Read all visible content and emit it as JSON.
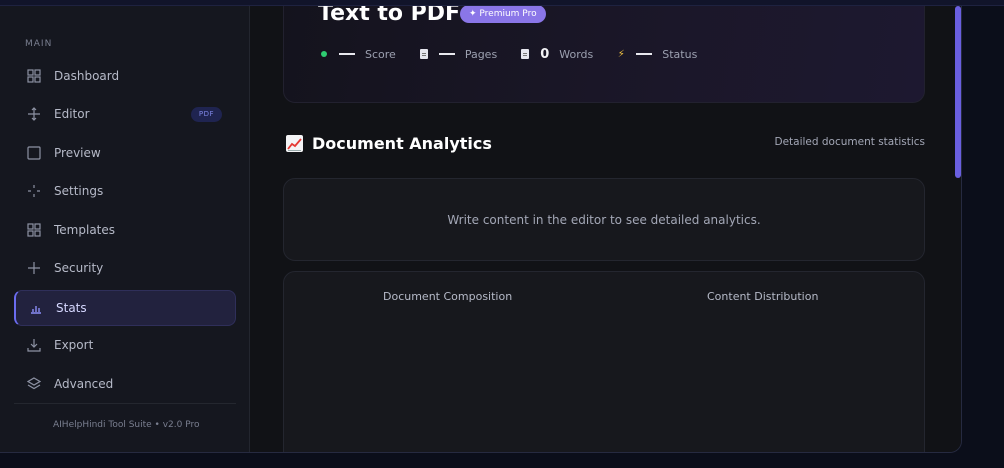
{
  "sidebar": {
    "section_label": "MAIN",
    "items": [
      {
        "label": "Dashboard",
        "icon": "grid-icon"
      },
      {
        "label": "Editor",
        "icon": "move-icon",
        "badge": "PDF"
      },
      {
        "label": "Preview",
        "icon": "square-icon"
      },
      {
        "label": "Settings",
        "icon": "sparkle-icon"
      },
      {
        "label": "Templates",
        "icon": "grid-icon"
      },
      {
        "label": "Security",
        "icon": "plus-icon"
      },
      {
        "label": "Stats",
        "icon": "bar-chart-icon",
        "active": true
      },
      {
        "label": "Export",
        "icon": "download-icon"
      },
      {
        "label": "Advanced",
        "icon": "layers-icon"
      }
    ],
    "footer": "AIHelpHindi Tool Suite • v2.0 Pro"
  },
  "hero": {
    "title": "Text to PDF",
    "badge": "✦ Premium Pro",
    "stats": [
      {
        "label": "Score",
        "icon": "status-dot-icon",
        "value": "",
        "color": "#2ecc71"
      },
      {
        "label": "Pages",
        "icon": "document-icon",
        "value": ""
      },
      {
        "label": "Words",
        "icon": "document-icon",
        "value": "0"
      },
      {
        "label": "Status",
        "icon": "lightning-icon",
        "value": "",
        "color": "#f5c542"
      }
    ]
  },
  "analytics": {
    "icon": "chart-increasing-icon",
    "title": "Document Analytics",
    "subtitle": "Detailed document statistics",
    "empty_message": "Write content in the editor to see detailed analytics.",
    "chart_titles": [
      "Document Composition",
      "Content Distribution"
    ]
  },
  "colors": {
    "accent": "#6b6cf0",
    "premium_badge": "#8a76e8"
  }
}
